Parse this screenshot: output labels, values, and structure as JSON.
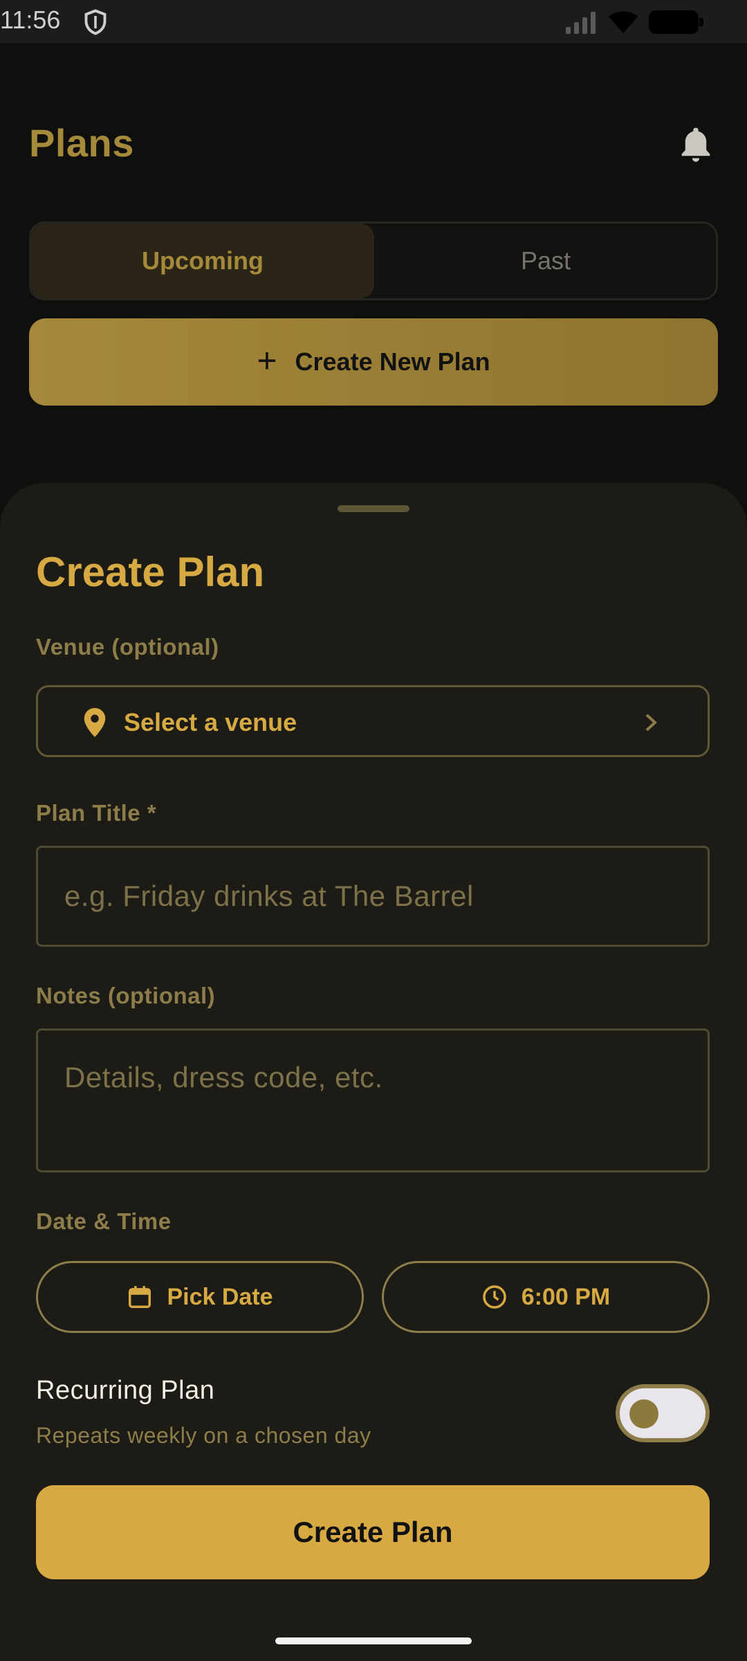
{
  "status_bar": {
    "time": "11:56",
    "icons": [
      "shield-icon",
      "signal-icon",
      "wifi-icon",
      "battery-icon"
    ]
  },
  "header": {
    "title": "Plans",
    "bell_icon": "bell-icon"
  },
  "tabs": [
    {
      "label": "Upcoming",
      "selected": true
    },
    {
      "label": "Past",
      "selected": false
    }
  ],
  "create_new_plan": {
    "icon": "plus-icon",
    "plus_glyph": "+",
    "label": "Create New Plan"
  },
  "sheet": {
    "title": "Create Plan",
    "venue": {
      "label": "Venue (optional)",
      "value": "Select a venue",
      "icon": "location-pin-icon"
    },
    "plan_title": {
      "label": "Plan Title *",
      "placeholder": "e.g. Friday drinks at The Barrel",
      "value": ""
    },
    "notes": {
      "label": "Notes (optional)",
      "placeholder": "Details, dress code, etc.",
      "value": ""
    },
    "date_time": {
      "label": "Date & Time",
      "date_button": "Pick Date",
      "date_icon": "calendar-icon",
      "time_button": "6:00 PM",
      "time_icon": "clock-icon"
    },
    "recurring": {
      "title": "Recurring Plan",
      "subtitle": "Repeats weekly on a chosen day",
      "enabled": false
    },
    "submit_label": "Create Plan"
  },
  "colors": {
    "accent": "#d6a943",
    "muted_accent": "#a58a3c",
    "background": "#0f0f0e",
    "sheet_background": "#1c1b16"
  }
}
